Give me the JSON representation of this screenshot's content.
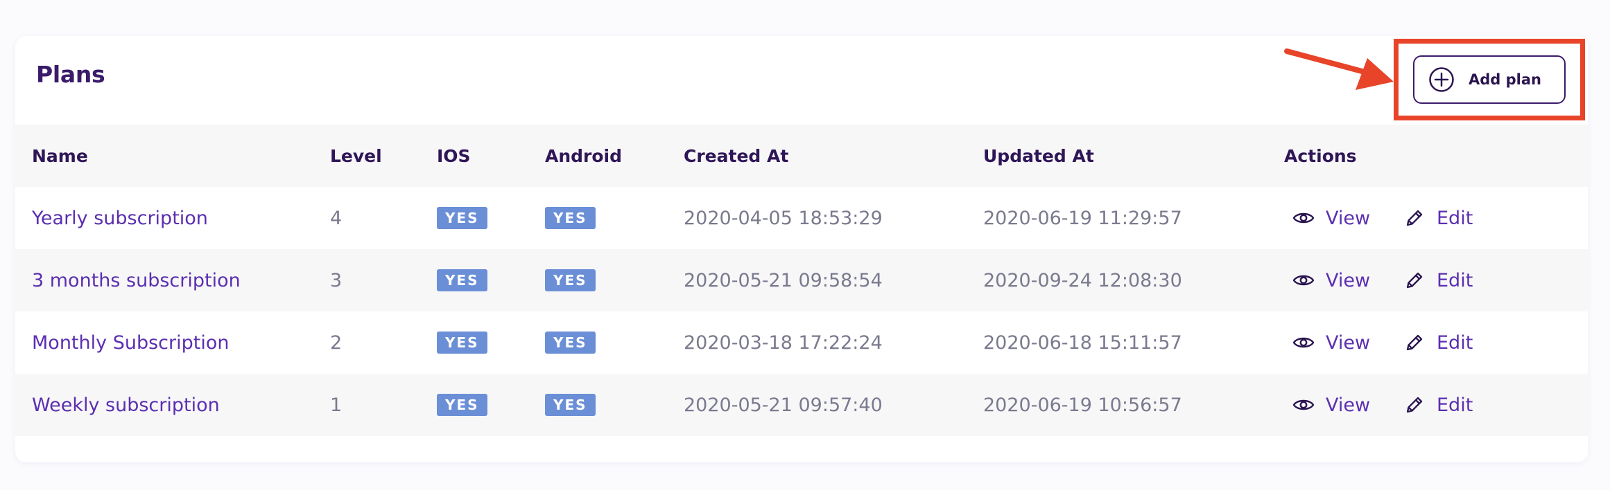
{
  "header": {
    "title": "Plans",
    "add_button_label": "Add plan"
  },
  "table": {
    "columns": {
      "name": "Name",
      "level": "Level",
      "ios": "IOS",
      "android": "Android",
      "created_at": "Created At",
      "updated_at": "Updated At",
      "actions": "Actions"
    },
    "rows": [
      {
        "name": "Yearly subscription",
        "level": "4",
        "ios": "YES",
        "android": "YES",
        "created_at": "2020-04-05 18:53:29",
        "updated_at": "2020-06-19 11:29:57",
        "view": "View",
        "edit": "Edit"
      },
      {
        "name": "3 months subscription",
        "level": "3",
        "ios": "YES",
        "android": "YES",
        "created_at": "2020-05-21 09:58:54",
        "updated_at": "2020-09-24 12:08:30",
        "view": "View",
        "edit": "Edit"
      },
      {
        "name": "Monthly Subscription",
        "level": "2",
        "ios": "YES",
        "android": "YES",
        "created_at": "2020-03-18 17:22:24",
        "updated_at": "2020-06-18 15:11:57",
        "view": "View",
        "edit": "Edit"
      },
      {
        "name": "Weekly subscription",
        "level": "1",
        "ios": "YES",
        "android": "YES",
        "created_at": "2020-05-21 09:57:40",
        "updated_at": "2020-06-19 10:56:57",
        "view": "View",
        "edit": "Edit"
      }
    ]
  },
  "icons": {
    "add": "plus-circle-icon",
    "view": "eye-icon",
    "edit": "pencil-icon"
  },
  "colors": {
    "title": "#3a1a6a",
    "link": "#5b2fb0",
    "badge": "#6b8fd6",
    "highlight": "#e8442a"
  }
}
